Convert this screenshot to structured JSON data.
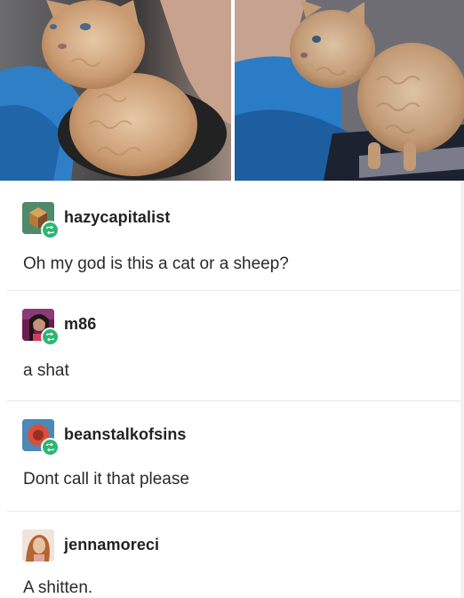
{
  "photos": [
    {
      "alt": "curly kitten photo 1",
      "icon": "kitten-photo"
    },
    {
      "alt": "curly kitten photo 2",
      "icon": "kitten-photo"
    }
  ],
  "thread": [
    {
      "username": "hazycapitalist",
      "message": "Oh my god is this a cat or a sheep?",
      "avatar_icon": "cube-avatar",
      "avatar_color": "#3c6e57"
    },
    {
      "username": "m86",
      "message": "a shat",
      "avatar_icon": "portrait-avatar",
      "avatar_color": "#5a1f4a"
    },
    {
      "username": "beanstalkofsins",
      "message": "Dont call it that please",
      "avatar_icon": "circle-avatar",
      "avatar_color": "#4a7da6"
    },
    {
      "username": "jennamoreci",
      "message": "A shitten.",
      "avatar_icon": "portrait-avatar",
      "avatar_color": "#c98a6a"
    }
  ],
  "colors": {
    "reblog_badge": "#2bb673",
    "divider": "#e7e7e7",
    "text": "#222222"
  }
}
